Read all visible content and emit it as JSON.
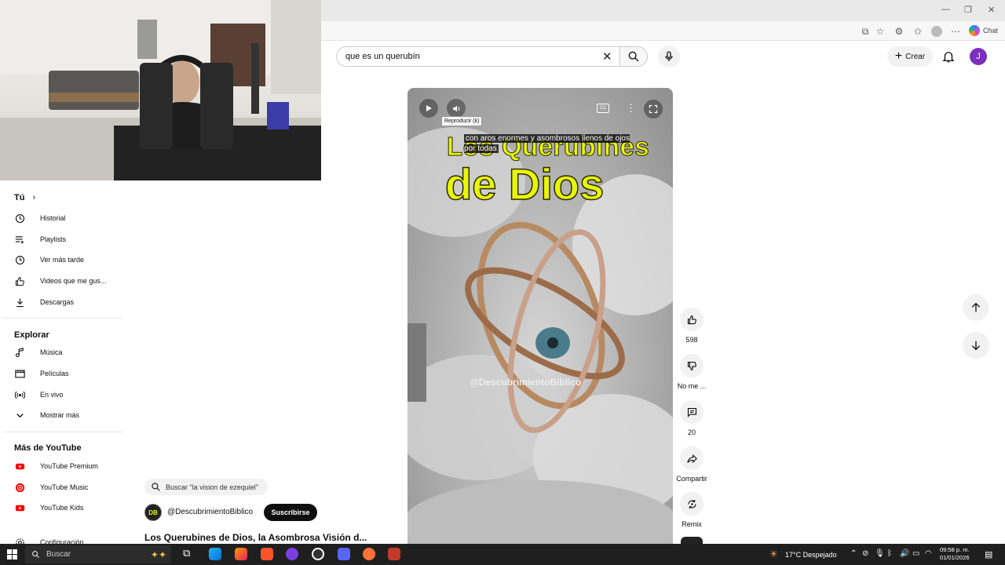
{
  "browser": {
    "window_controls": [
      "—",
      "❐",
      "✕"
    ],
    "chat_label": "Chat"
  },
  "header": {
    "search_value": "que es un querubín",
    "crear_label": "Crear",
    "avatar_letter": "J"
  },
  "sidebar": {
    "tu": {
      "title": "Tú",
      "items": [
        {
          "label": "Historial",
          "icon": "history-icon"
        },
        {
          "label": "Playlists",
          "icon": "playlist-icon"
        },
        {
          "label": "Ver más tarde",
          "icon": "clock-icon"
        },
        {
          "label": "Videos que me gus...",
          "icon": "thumbs-up-icon"
        },
        {
          "label": "Descargas",
          "icon": "download-icon"
        }
      ]
    },
    "explorar": {
      "title": "Explorar",
      "items": [
        {
          "label": "Música",
          "icon": "music-note-icon"
        },
        {
          "label": "Películas",
          "icon": "film-icon"
        },
        {
          "label": "En vivo",
          "icon": "live-icon"
        },
        {
          "label": "Mostrar más",
          "icon": "chevron-down-icon"
        }
      ]
    },
    "mas": {
      "title": "Más de YouTube",
      "items": [
        {
          "label": "YouTube Premium",
          "icon": "youtube-premium-icon"
        },
        {
          "label": "YouTube Music",
          "icon": "youtube-music-icon"
        },
        {
          "label": "YouTube Kids",
          "icon": "youtube-kids-icon"
        },
        {
          "label": "Configuración",
          "icon": "gear-icon"
        }
      ]
    }
  },
  "video": {
    "title_line1": "Los Querubines",
    "title_line2": "de Dios",
    "caption": "con aros enormes y asombrosos llenos de ojos por todas",
    "tooltip": "Reproducir (k)",
    "watermark": "@DescubrimientoBiblico",
    "cc_label": "CC"
  },
  "actions": {
    "likes": "598",
    "dislike": "No me ...",
    "comments": "20",
    "share": "Compartir",
    "remix": "Remix"
  },
  "below_video": {
    "suggestion": "Buscar \"la vision de ezequiel\"",
    "channel": "@DescubrimientoBiblico",
    "channel_initials": "DB",
    "subscribe": "Suscribirse",
    "title": "Los Querubines de Dios, la Asombrosa Visión d..."
  },
  "taskbar": {
    "search": "Buscar",
    "weather": "17°C  Despejado",
    "time": "09:58 p. m.",
    "date": "01/01/2026"
  },
  "colors": {
    "accent_avatar": "#7b2fbe",
    "video_title_yellow": "#e8f50a",
    "youtube_red": "#ff0000",
    "taskbar": "#1f1f1f"
  }
}
